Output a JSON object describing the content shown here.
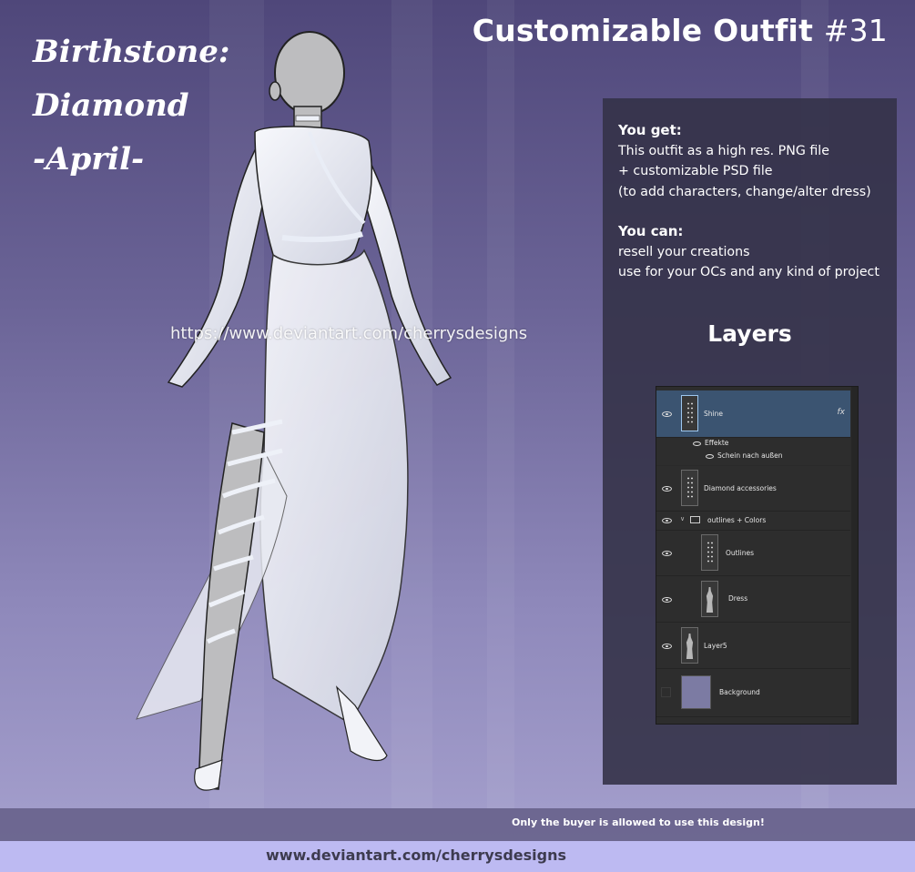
{
  "birthstone": {
    "line1": "Birthstone:",
    "line2": "Diamond",
    "line3": "-April-"
  },
  "title": {
    "main": "Customizable Outfit",
    "number": "#31"
  },
  "watermark": "https://www.deviantart.com/cherrysdesigns",
  "info": {
    "you_get_heading": "You get:",
    "you_get_lines": [
      "This outfit as a high res. PNG file",
      "+ customizable PSD file",
      "(to add characters, change/alter dress)"
    ],
    "you_can_heading": "You can:",
    "you_can_lines": [
      "resell your creations",
      "use for your OCs and any kind of project"
    ]
  },
  "layers": {
    "title": "Layers",
    "rows": [
      {
        "name": "Shine",
        "fx": "fx",
        "effects_label": "Effekte",
        "effect": "Schein nach außen",
        "icon": "figure-thumbnail"
      },
      {
        "name": "Diamond accessories",
        "icon": "dots-thumbnail"
      },
      {
        "name": "outlines + Colors",
        "icon": "folder-icon"
      },
      {
        "name": "Outlines",
        "icon": "dots-thumbnail"
      },
      {
        "name": "Dress",
        "icon": "figure-thumbnail"
      },
      {
        "name": "Layer5",
        "icon": "figure-thumbnail"
      },
      {
        "name": "Background",
        "icon": "color-thumbnail"
      }
    ]
  },
  "footer": {
    "note": "Only the buyer is allowed to use this design!",
    "url": "www.deviantart.com/cherrysdesigns"
  },
  "colors": {
    "background_top": "#4f477a",
    "background_bottom": "#a7a2cf",
    "panel": "#343248",
    "selected_layer": "#3b5471",
    "bottom_band": "#bdbaf2"
  }
}
